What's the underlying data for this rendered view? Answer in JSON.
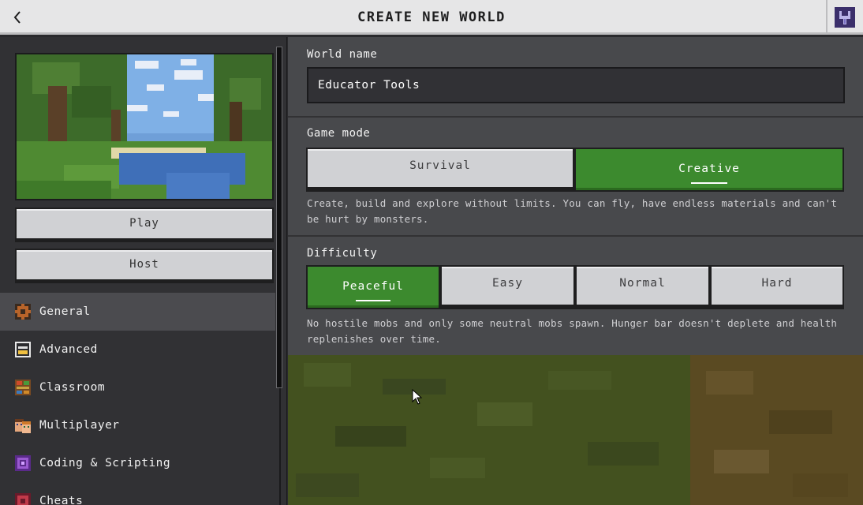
{
  "header": {
    "title": "CREATE NEW WORLD",
    "back_icon": "chevron-left-icon",
    "tools_icon": "wrench-icon"
  },
  "left_panel": {
    "play_label": "Play",
    "host_label": "Host",
    "nav_items": [
      {
        "label": "General",
        "icon": "gear-icon",
        "active": true
      },
      {
        "label": "Advanced",
        "icon": "advanced-icon",
        "active": false
      },
      {
        "label": "Classroom",
        "icon": "classroom-icon",
        "active": false
      },
      {
        "label": "Multiplayer",
        "icon": "multiplayer-icon",
        "active": false
      },
      {
        "label": "Coding & Scripting",
        "icon": "coding-icon",
        "active": false
      },
      {
        "label": "Cheats",
        "icon": "cheats-icon",
        "active": false
      }
    ]
  },
  "general": {
    "world_name_label": "World name",
    "world_name_value": "Educator Tools",
    "game_mode_label": "Game mode",
    "game_modes": [
      {
        "label": "Survival",
        "selected": false
      },
      {
        "label": "Creative",
        "selected": true
      }
    ],
    "game_mode_description": "Create, build and explore without limits. You can fly, have endless materials and can't be hurt by monsters.",
    "difficulty_label": "Difficulty",
    "difficulties": [
      {
        "label": "Peaceful",
        "selected": true
      },
      {
        "label": "Easy",
        "selected": false
      },
      {
        "label": "Normal",
        "selected": false
      },
      {
        "label": "Hard",
        "selected": false
      }
    ],
    "difficulty_description": "No hostile mobs and only some neutral mobs spawn. Hunger bar doesn't deplete and health replenishes over time."
  },
  "colors": {
    "accent_green": "#3c8a2e",
    "header_bg": "#e6e6e7",
    "panel_bg": "#48494c",
    "sidebar_bg": "#313134"
  }
}
